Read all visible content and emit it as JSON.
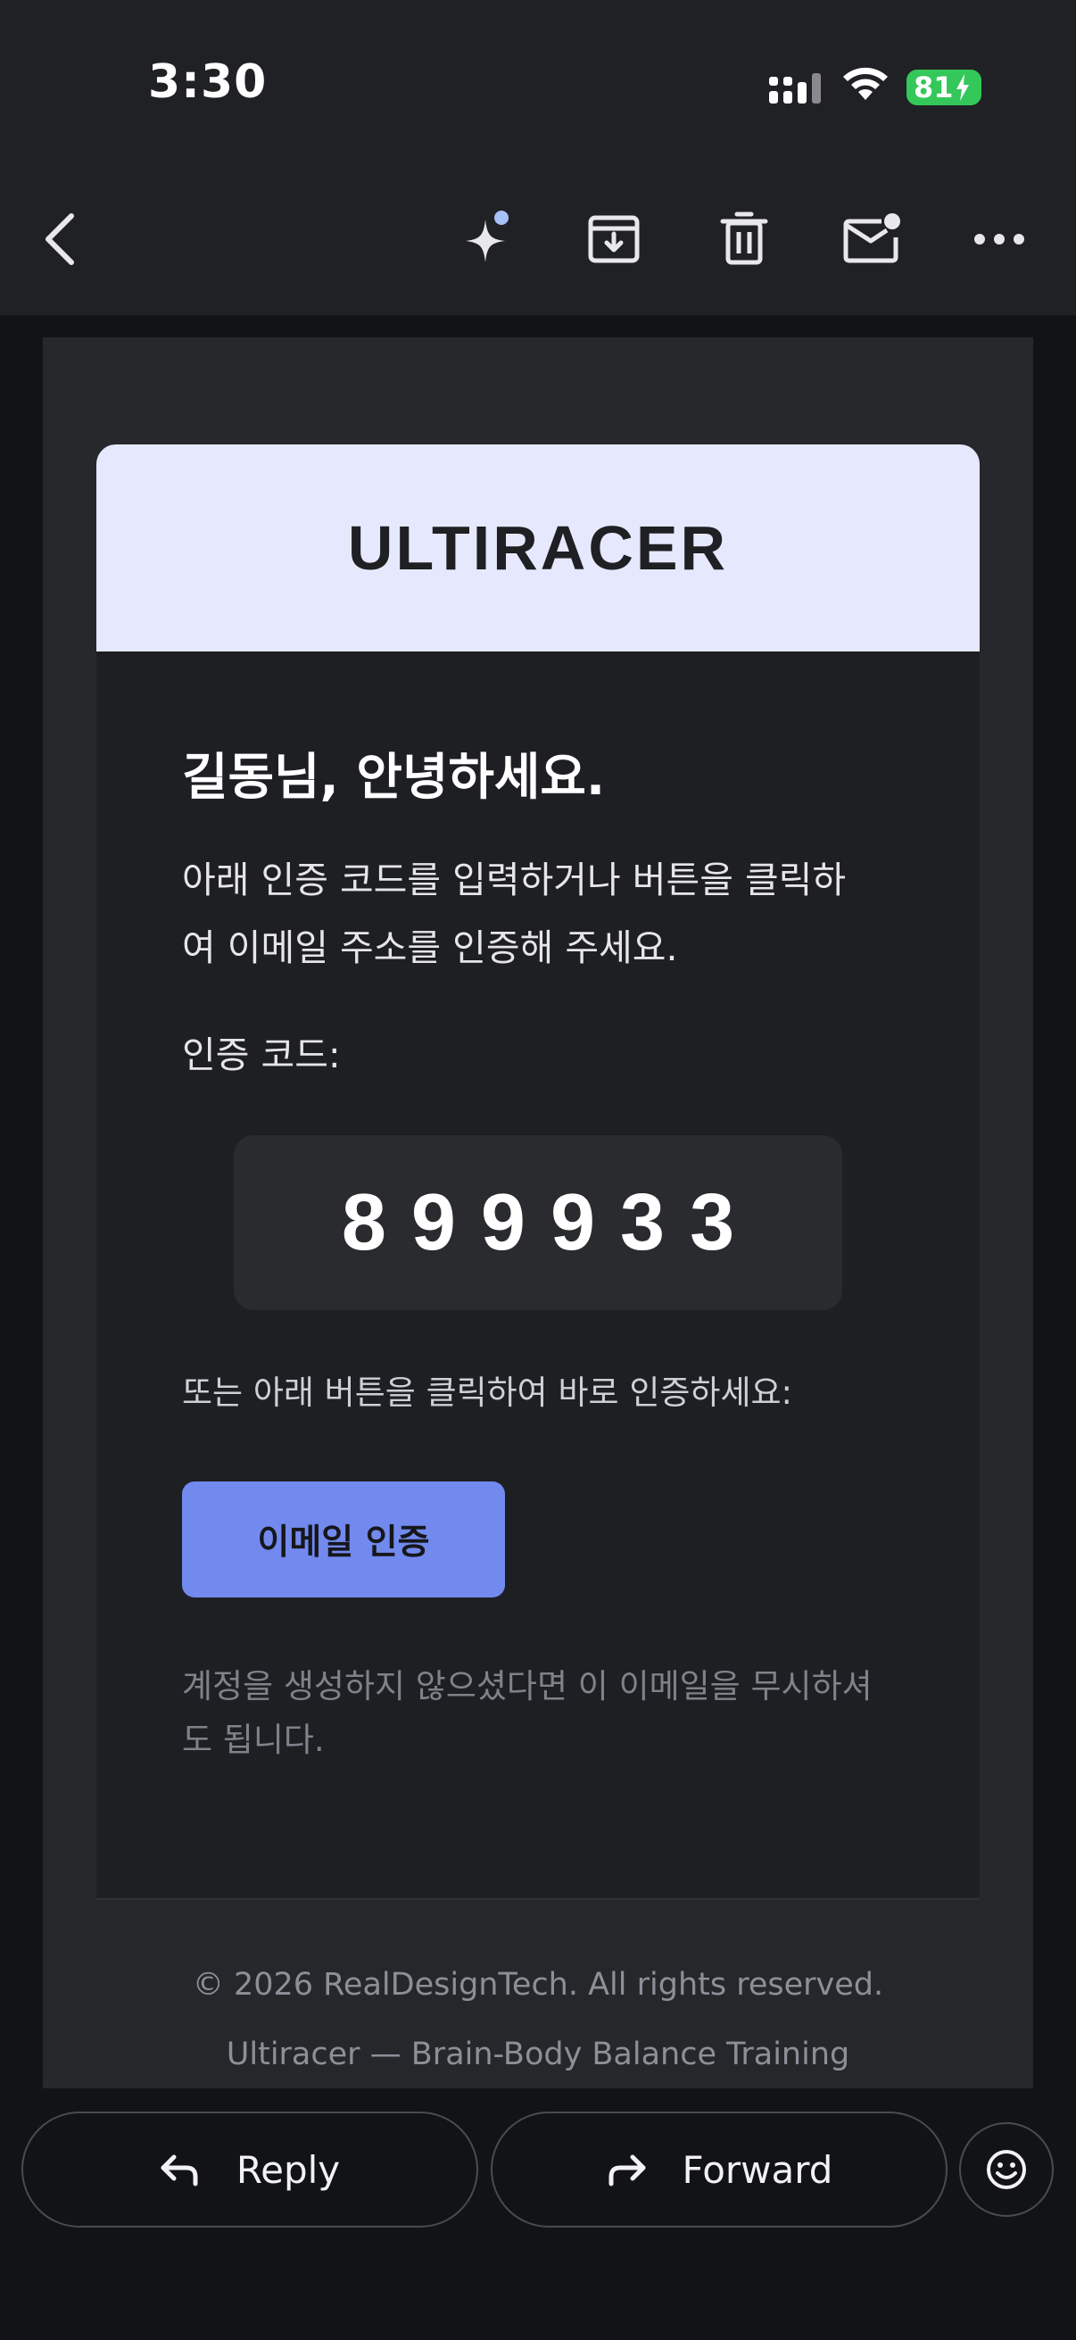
{
  "status_bar": {
    "time": "3:30",
    "battery": "81"
  },
  "toolbar": {
    "icons": [
      "back-icon",
      "sparkle-icon",
      "archive-icon",
      "trash-icon",
      "mark-unread-icon",
      "more-icon"
    ]
  },
  "email": {
    "brand": "ULTIRACER",
    "greeting": "길동님, 안녕하세요.",
    "instructions_line1": "아래 인증 코드를 입력하거나 버튼을 클릭하",
    "instructions_line2": "여 이메일 주소를 인증해 주세요.",
    "code_label": "인증 코드:",
    "code": "899933",
    "alt_text": "또는 아래 버튼을 클릭하여 바로 인증하세요:",
    "verify_button": "이메일 인증",
    "ignore_line1": "계정을 생성하지 않으셨다면 이 이메일을 무시하셔",
    "ignore_line2": "도 됩니다.",
    "footer_copyright": "© 2026 RealDesignTech. All rights reserved.",
    "footer_tagline": "Ultiracer — Brain-Body Balance Training"
  },
  "actions": {
    "reply": "Reply",
    "forward": "Forward"
  },
  "colors": {
    "accent": "#7289ee",
    "header_band": "#e6e9fd",
    "battery": "#34c759"
  }
}
